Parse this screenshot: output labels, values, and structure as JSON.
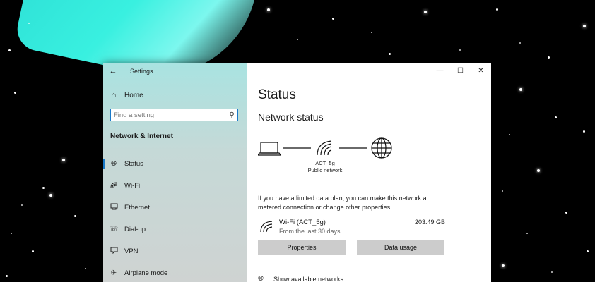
{
  "window": {
    "app_title": "Settings",
    "controls": {
      "minimize": "—",
      "maximize": "☐",
      "close": "✕"
    }
  },
  "nav": {
    "back_icon": "arrow-left-icon",
    "home": {
      "icon": "home-icon",
      "label": "Home"
    },
    "search": {
      "placeholder": "Find a setting",
      "value": ""
    },
    "section_title": "Network & Internet",
    "items": [
      {
        "icon": "globe-icon",
        "label": "Status",
        "active": true
      },
      {
        "icon": "wifi-icon",
        "label": "Wi-Fi"
      },
      {
        "icon": "ethernet-icon",
        "label": "Ethernet"
      },
      {
        "icon": "dialup-icon",
        "label": "Dial-up"
      },
      {
        "icon": "vpn-icon",
        "label": "VPN"
      },
      {
        "icon": "airplane-icon",
        "label": "Airplane mode"
      }
    ]
  },
  "main": {
    "page_title": "Status",
    "section_title": "Network status",
    "network": {
      "name": "ACT_5g",
      "type": "Public network"
    },
    "info_text": "If you have a limited data plan, you can make this network a metered connection or change other properties.",
    "connection": {
      "name": "Wi-Fi (ACT_5g)",
      "period": "From the last 30 days",
      "usage": "203.49 GB"
    },
    "buttons": {
      "properties": "Properties",
      "data_usage": "Data usage"
    },
    "show_networks": "Show available networks"
  },
  "colors": {
    "accent": "#1979c9",
    "button_bg": "#cccccc",
    "nav_tint": "#a9e3e1"
  }
}
